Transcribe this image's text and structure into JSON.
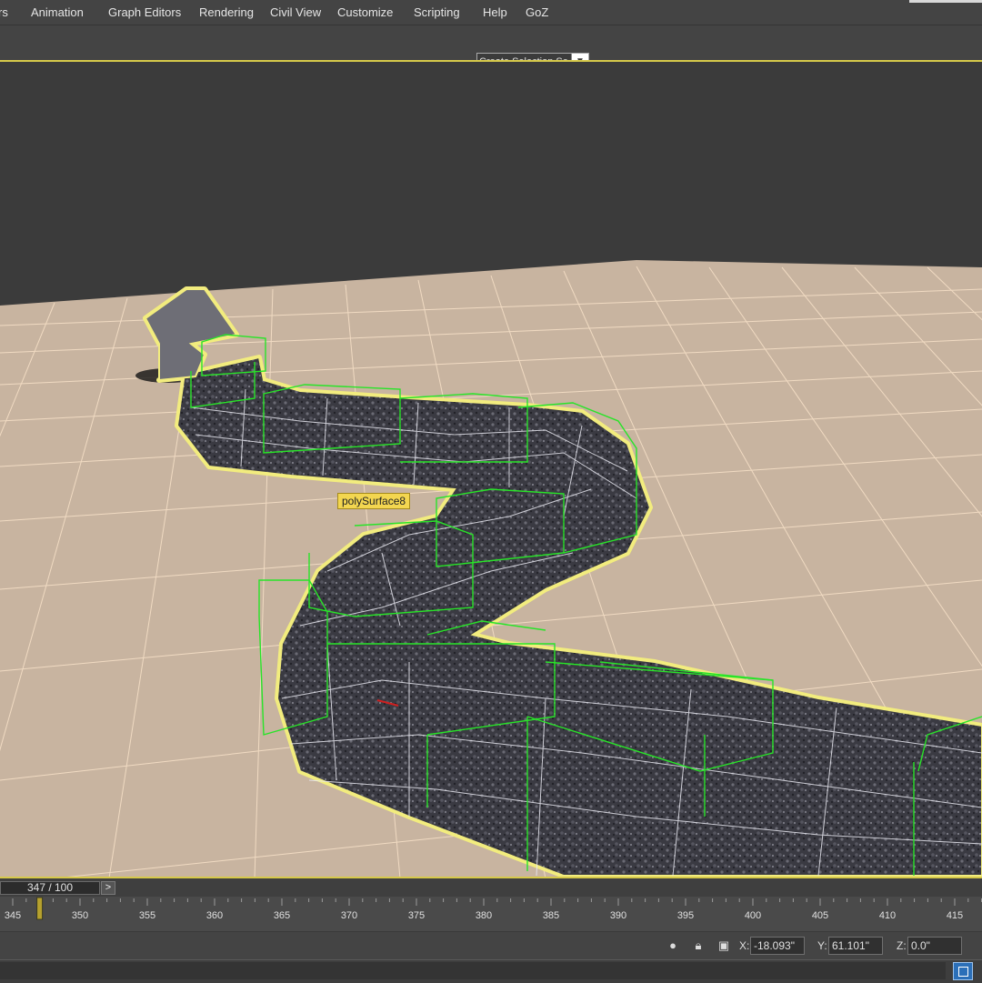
{
  "menu": {
    "items": [
      "rs",
      "Animation",
      "Graph Editors",
      "Rendering",
      "Civil View",
      "Customize",
      "Scripting",
      "Help",
      "GoZ"
    ]
  },
  "toolbar": {
    "selection_set_value": "Create Selection Se"
  },
  "viewport": {
    "object_label": "polySurface8",
    "colors": {
      "background": "#3b3b3b",
      "ground": "#c7b3a0",
      "grid": "#f2dcc3",
      "selection_outline": "#f2ec7e",
      "bones": "#27e427",
      "mesh": "#3a3a42"
    }
  },
  "timeline": {
    "slider_text": "347 / 100",
    "next_label": ">",
    "ruler_labels": [
      "345",
      "350",
      "355",
      "360",
      "365",
      "370",
      "375",
      "380",
      "385",
      "390",
      "395",
      "400",
      "405",
      "410",
      "415"
    ],
    "current_frame": 347
  },
  "status": {
    "x_label": "X:",
    "x_value": "-18.093\"",
    "y_label": "Y:",
    "y_value": "61.101\"",
    "z_label": "Z:",
    "z_value": "0.0\"",
    "icons": [
      "light-bulb-icon",
      "lock-icon",
      "transform-type-in-icon"
    ]
  },
  "bottom": {
    "maximize_icon": "maximize-viewport-icon"
  }
}
